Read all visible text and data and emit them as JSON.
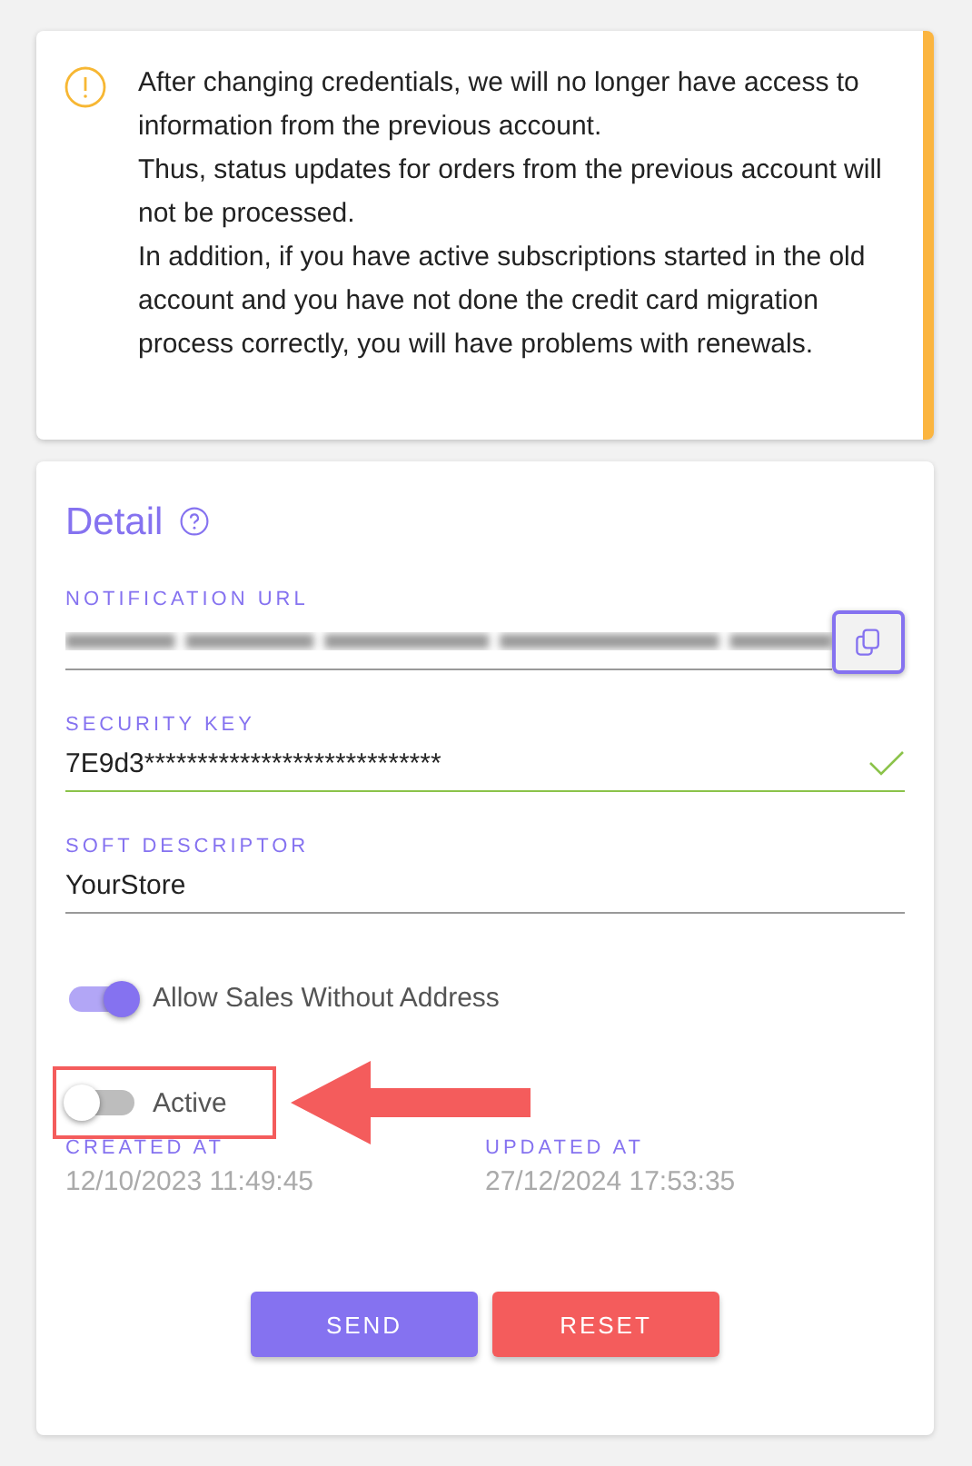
{
  "alert": {
    "paragraphs": [
      "After changing credentials, we will no longer have access to information from the previous account.",
      "Thus, status updates for orders from the previous account will not be processed.",
      "In addition, if you have active subscriptions started in the old account and you have not done the credit card migration process correctly, you will have problems with renewals."
    ]
  },
  "detail": {
    "title": "Detail",
    "fields": [
      {
        "label": "NOTIFICATION URL",
        "kind": "blurred",
        "valid": false
      },
      {
        "label": "SECURITY KEY",
        "kind": "text",
        "value": "7E9d3****************************",
        "valid": true
      },
      {
        "label": "SOFT DESCRIPTOR",
        "kind": "text",
        "value": "YourStore",
        "valid": false
      }
    ],
    "toggles": [
      {
        "label": "Allow Sales Without Address",
        "on": true,
        "highlighted": false
      },
      {
        "label": "Active",
        "on": false,
        "highlighted": true
      }
    ],
    "dates": [
      {
        "label": "CREATED AT",
        "value": "12/10/2023 11:49:45"
      },
      {
        "label": "UPDATED AT",
        "value": "27/12/2024 17:53:35"
      }
    ],
    "buttons": [
      {
        "label": "SEND",
        "kind": "primary"
      },
      {
        "label": "RESET",
        "kind": "danger"
      }
    ]
  }
}
